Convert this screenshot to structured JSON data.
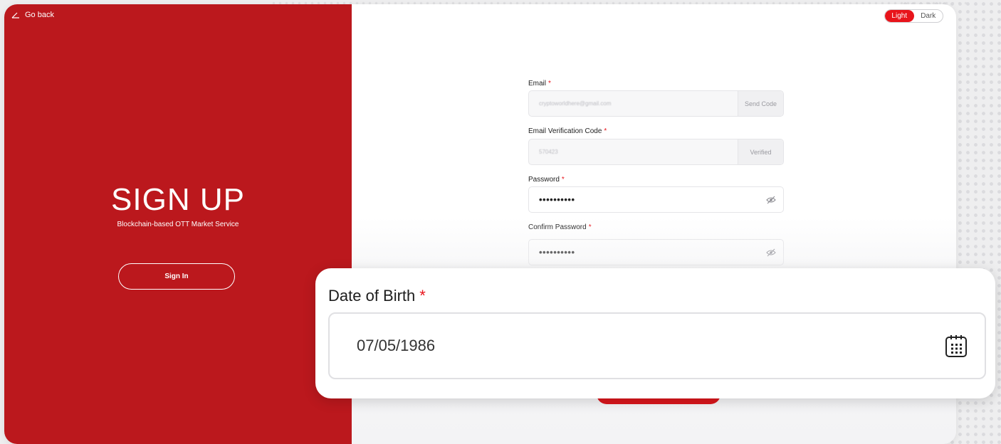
{
  "nav": {
    "go_back": "Go back"
  },
  "hero": {
    "title": "SIGN UP",
    "subtitle": "Blockchain-based OTT Market Service",
    "signin_label": "Sign In"
  },
  "theme": {
    "light": "Light",
    "dark": "Dark",
    "selected": "Light"
  },
  "form": {
    "email": {
      "label": "Email",
      "required_mark": "*",
      "value": "cryptoworldhere@gmail.com",
      "button": "Send Code"
    },
    "code": {
      "label": "Email Verification Code",
      "required_mark": "*",
      "value": "570423",
      "button": "Verified"
    },
    "password": {
      "label": "Password",
      "required_mark": "*",
      "value": "••••••••••"
    },
    "confirm": {
      "label": "Confirm Password",
      "required_mark": "*",
      "value": "••••••••••"
    },
    "dob": {
      "label": "Date of Birth",
      "required_mark": "*",
      "value": "07/05/1986"
    }
  },
  "icons": {
    "back": "back-arrow-icon",
    "eye": "eye-slash-icon",
    "calendar": "calendar-icon"
  },
  "colors": {
    "brand_red": "#bb181d",
    "accent_red": "#e8141b"
  }
}
